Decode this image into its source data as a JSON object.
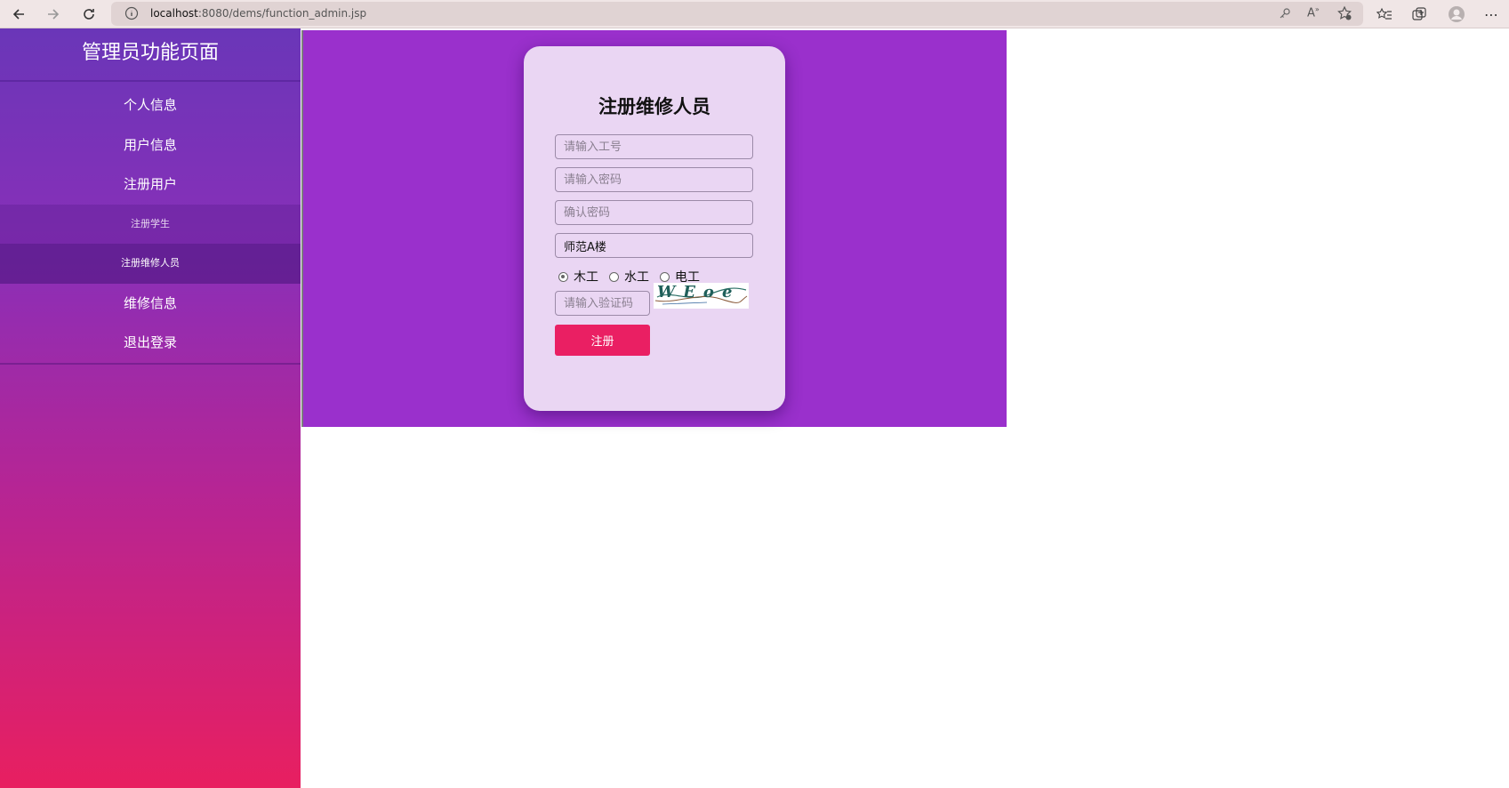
{
  "browser": {
    "url_host": "localhost",
    "url_rest": ":8080/dems/function_admin.jsp"
  },
  "sidebar": {
    "title": "管理员功能页面",
    "items": [
      {
        "label": "个人信息"
      },
      {
        "label": "用户信息"
      },
      {
        "label": "注册用户"
      },
      {
        "label": "注册学生"
      },
      {
        "label": "注册维修人员"
      },
      {
        "label": "维修信息"
      },
      {
        "label": "退出登录"
      }
    ]
  },
  "form": {
    "title": "注册维修人员",
    "employee_id_placeholder": "请输入工号",
    "password_placeholder": "请输入密码",
    "confirm_placeholder": "确认密码",
    "building_value": "师范A楼",
    "radio_options": [
      "木工",
      "水工",
      "电工"
    ],
    "captcha_placeholder": "请输入验证码",
    "captcha_text": "WEoe",
    "submit_label": "注册"
  },
  "colors": {
    "frame_bg": "#9a30cc",
    "card_bg": "#ead6f3",
    "submit_bg": "#ea1f63"
  }
}
